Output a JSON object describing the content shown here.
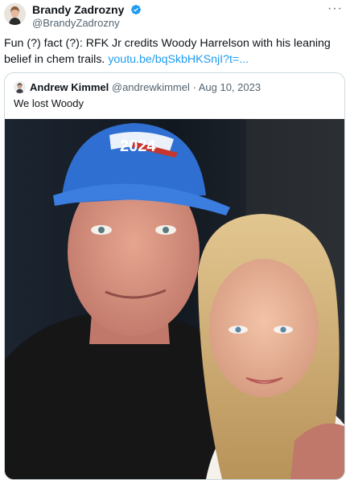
{
  "tweet": {
    "author_name": "Brandy Zadrozny",
    "author_handle": "@BrandyZadrozny",
    "text": "Fun (?) fact (?): RFK Jr credits Woody Harrelson with his leaning belief in chem trails. ",
    "link": "youtu.be/bqSkbHKSnjI?t=...",
    "more_label": "···"
  },
  "quote": {
    "author_name": "Andrew Kimmel",
    "author_handle": "@andrewkimmel",
    "separator": " · ",
    "date": "Aug 10, 2023",
    "text": "We lost Woody",
    "hat_text": "2024"
  },
  "colors": {
    "link": "#1d9bf0",
    "verified": "#1d9bf0",
    "secondary_text": "#536471",
    "border": "#cfd9de"
  },
  "icons": [
    "verified-badge-icon",
    "more-icon"
  ]
}
